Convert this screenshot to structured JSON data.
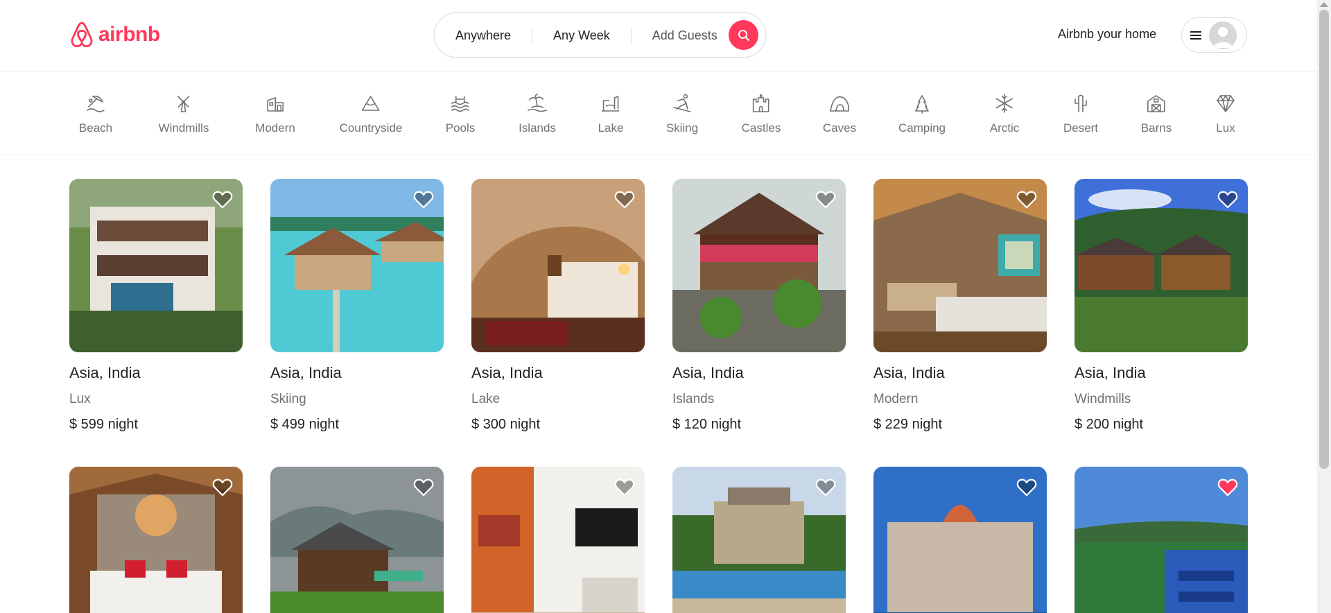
{
  "header": {
    "logo_text": "airbnb",
    "brand_color": "#ff385c",
    "search": {
      "where": "Anywhere",
      "when": "Any Week",
      "guests": "Add Guests"
    },
    "host_link": "Airbnb your home"
  },
  "categories": [
    {
      "label": "Beach",
      "icon": "beach-icon"
    },
    {
      "label": "Windmills",
      "icon": "windmill-icon"
    },
    {
      "label": "Modern",
      "icon": "modern-house-icon"
    },
    {
      "label": "Countryside",
      "icon": "mountain-icon"
    },
    {
      "label": "Pools",
      "icon": "pool-icon"
    },
    {
      "label": "Islands",
      "icon": "island-icon"
    },
    {
      "label": "Lake",
      "icon": "lake-icon"
    },
    {
      "label": "Skiing",
      "icon": "skiing-icon"
    },
    {
      "label": "Castles",
      "icon": "castle-icon"
    },
    {
      "label": "Caves",
      "icon": "cave-icon"
    },
    {
      "label": "Camping",
      "icon": "camping-icon"
    },
    {
      "label": "Arctic",
      "icon": "snowflake-icon"
    },
    {
      "label": "Desert",
      "icon": "cactus-icon"
    },
    {
      "label": "Barns",
      "icon": "barn-icon"
    },
    {
      "label": "Lux",
      "icon": "diamond-icon"
    }
  ],
  "listings": [
    {
      "location": "Asia, India",
      "category": "Lux",
      "price": "$ 599",
      "unit": "night",
      "favorited": false
    },
    {
      "location": "Asia, India",
      "category": "Skiing",
      "price": "$ 499",
      "unit": "night",
      "favorited": false
    },
    {
      "location": "Asia, India",
      "category": "Lake",
      "price": "$ 300",
      "unit": "night",
      "favorited": false
    },
    {
      "location": "Asia, India",
      "category": "Islands",
      "price": "$ 120",
      "unit": "night",
      "favorited": false
    },
    {
      "location": "Asia, India",
      "category": "Modern",
      "price": "$ 229",
      "unit": "night",
      "favorited": false
    },
    {
      "location": "Asia, India",
      "category": "Windmills",
      "price": "$ 200",
      "unit": "night",
      "favorited": false
    },
    {
      "favorited": false
    },
    {
      "favorited": false
    },
    {
      "favorited": false
    },
    {
      "favorited": false
    },
    {
      "favorited": false
    },
    {
      "favorited": true
    }
  ]
}
